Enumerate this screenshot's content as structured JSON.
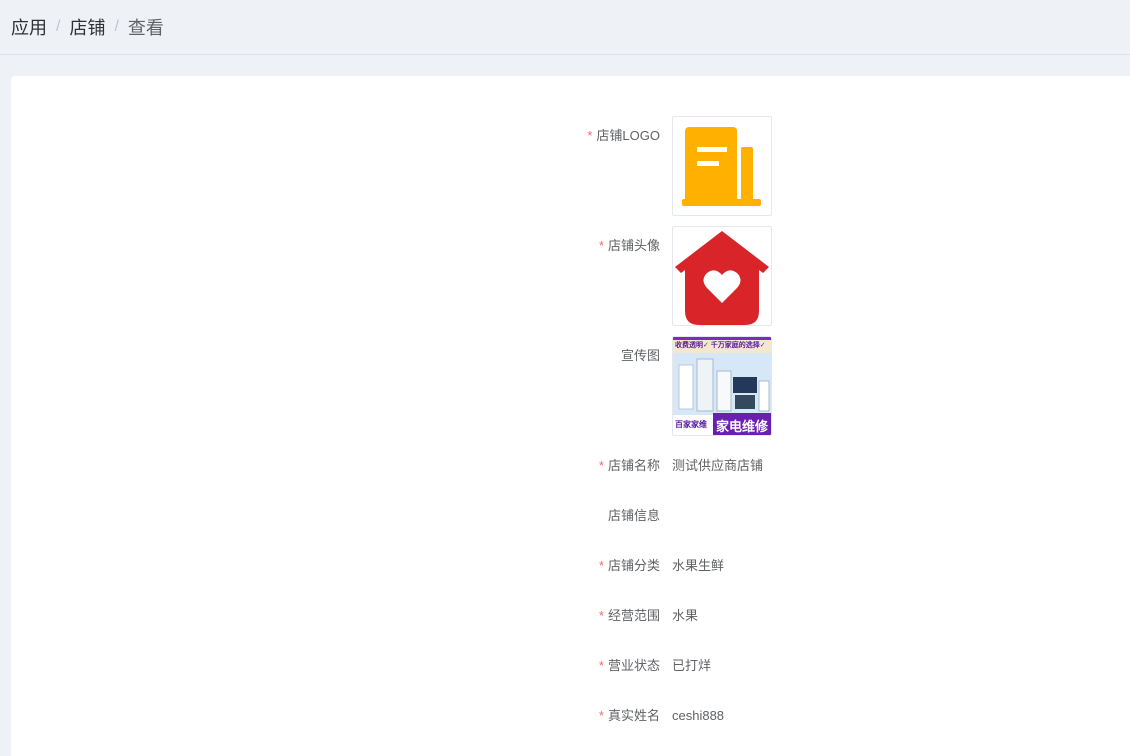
{
  "breadcrumb": {
    "items": [
      "应用",
      "店铺",
      "查看"
    ],
    "separator": "/"
  },
  "form": {
    "required_mark": "*",
    "logo": {
      "label": "店铺LOGO",
      "required": true,
      "icon": "building-icon",
      "color": "#ffb000"
    },
    "avatar": {
      "label": "店铺头像",
      "required": true,
      "icon": "house-heart-icon",
      "color": "#d9252a"
    },
    "promo": {
      "label": "宣传图",
      "required": false,
      "banner_top": "收费透明✓  千万家庭的选择✓",
      "brand": "百家家维",
      "title": "家电维修"
    },
    "fields": [
      {
        "label": "店铺名称",
        "required": true,
        "value": "测试供应商店铺"
      },
      {
        "label": "店铺信息",
        "required": false,
        "value": ""
      },
      {
        "label": "店铺分类",
        "required": true,
        "value": "水果生鲜"
      },
      {
        "label": "经营范围",
        "required": true,
        "value": "水果"
      },
      {
        "label": "营业状态",
        "required": true,
        "value": "已打烊"
      },
      {
        "label": "真实姓名",
        "required": true,
        "value": "ceshi888"
      }
    ]
  }
}
